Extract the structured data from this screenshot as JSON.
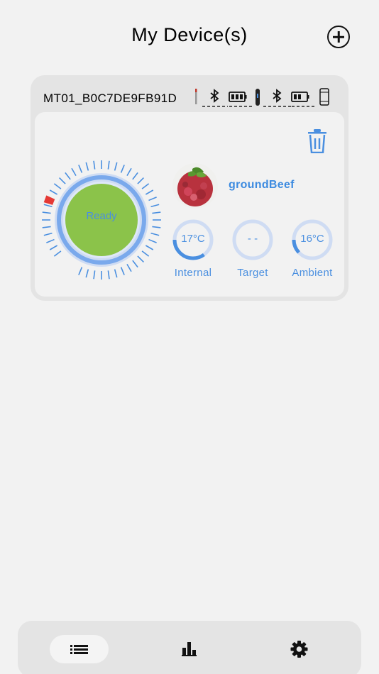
{
  "header": {
    "title": "My Device(s)"
  },
  "device": {
    "id": "MT01_B0C7DE9FB91D",
    "food": {
      "name": "groundBeef"
    },
    "dial": {
      "status": "Ready"
    },
    "temps": [
      {
        "key": "internal",
        "value": "17°C",
        "label": "Internal",
        "level": 0.35
      },
      {
        "key": "target",
        "value": "- -",
        "label": "Target",
        "level": 0
      },
      {
        "key": "ambient",
        "value": "16°C",
        "label": "Ambient",
        "level": 0.12
      }
    ]
  },
  "colors": {
    "accent": "#4a8fe0",
    "ready_green": "#8bc34a",
    "alert_red": "#e53935",
    "ring_light": "#cfdcf3"
  },
  "icons": {
    "add": "add-circle-icon",
    "trash": "trash-icon",
    "tabs": [
      "list-icon",
      "bar-chart-icon",
      "gear-icon"
    ]
  }
}
